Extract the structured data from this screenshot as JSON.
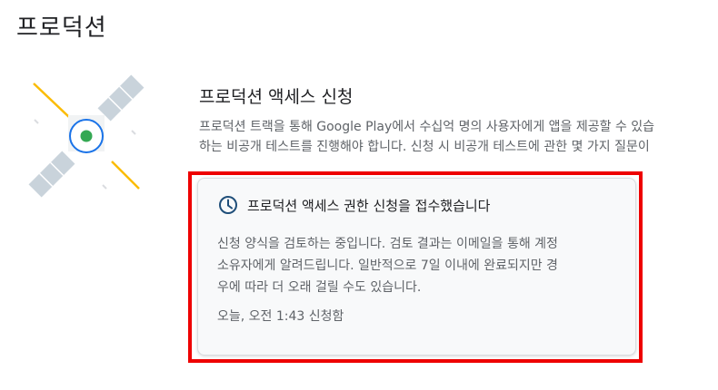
{
  "page": {
    "title": "프로덕션"
  },
  "illustration": {
    "icon": "satellite-illustration",
    "colors": {
      "panel": "#c9d3db",
      "core_ring": "#1a73e8",
      "core_dot": "#34a853",
      "beam": "#fbbc04"
    }
  },
  "section": {
    "title": "프로덕션 액세스 신청",
    "description_lines": [
      "프로덕션 트랙을 통해 Google Play에서 수십억 명의 사용자에게 앱을 제공할 수 있습",
      "하는 비공개 테스트를 진행해야 합니다. 신청 시 비공개 테스트에 관한 몇 가지 질문이"
    ]
  },
  "status_card": {
    "icon": "clock-icon",
    "title": "프로덕션 액세스 권한 신청을 접수했습니다",
    "body_lines": [
      "신청 양식을 검토하는 중입니다. 검토 결과는 이메일을 통해 계정",
      "소유자에게 알려드립니다. 일반적으로 7일 이내에 완료되지만 경",
      "우에 따라 더 오래 걸릴 수도 있습니다."
    ],
    "timestamp": "오늘, 오전 1:43 신청함",
    "accent_color": "#1f4e79",
    "highlight_color": "#ee0000"
  }
}
